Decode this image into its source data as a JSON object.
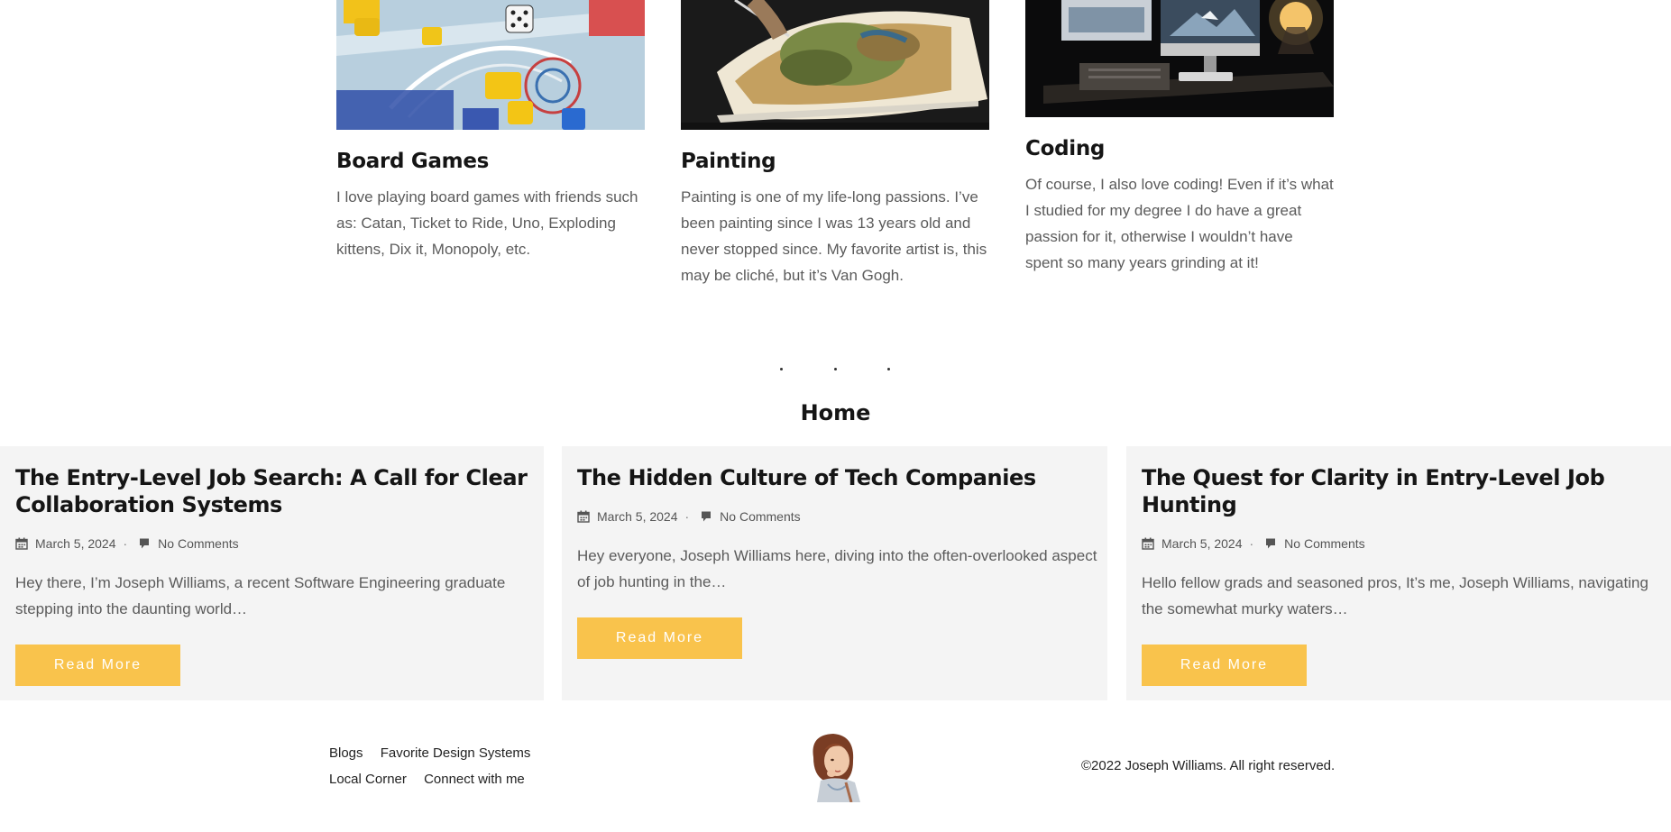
{
  "hobbies": [
    {
      "image": "board-games-photo",
      "title": "Board Games",
      "text": "I love playing board games with friends such as: Catan, Ticket to Ride, Uno, Exploding kittens, Dix it, Monopoly, etc."
    },
    {
      "image": "painting-photo",
      "title": "Painting",
      "text": "Painting is one of my life-long passions. I’ve been painting since I was 13 years old and never stopped since. My favorite artist is, this may be cliché, but it’s Van Gogh."
    },
    {
      "image": "coding-desk-photo",
      "title": "Coding",
      "text": "Of course, I also love coding! Even if it’s what I studied for my degree I do have a great passion for it, otherwise I wouldn’t have spent so many years grinding at it!"
    }
  ],
  "section_title": "Home",
  "posts": [
    {
      "title": "The Entry-Level Job Search: A Call for Clear Collaboration Systems",
      "date": "March 5, 2024",
      "comments": "No Comments",
      "excerpt": "Hey there, I’m Joseph Williams, a recent Software Engineering graduate stepping into the daunting world…",
      "button": "Read More"
    },
    {
      "title": "The Hidden Culture of Tech Companies",
      "date": "March 5, 2024",
      "comments": "No Comments",
      "excerpt": "Hey everyone, Joseph Williams here, diving into the often-overlooked aspect of job hunting in the…",
      "button": "Read More"
    },
    {
      "title": "The Quest for Clarity in Entry-Level Job Hunting",
      "date": "March 5, 2024",
      "comments": "No Comments",
      "excerpt": "Hello fellow grads and seasoned pros, It’s me, Joseph Williams, navigating the somewhat murky waters…",
      "button": "Read More"
    }
  ],
  "footer": {
    "links": [
      "Blogs",
      "Favorite Design Systems",
      "Local Corner",
      "Connect with me"
    ],
    "copyright": "©2022 Joseph Williams. All right reserved."
  },
  "colors": {
    "accent": "#f9c34c",
    "card_bg": "#f4f4f4",
    "heading": "#151515",
    "body_text": "#5b5b5b"
  },
  "icons": [
    "calendar-icon",
    "comment-icon"
  ]
}
